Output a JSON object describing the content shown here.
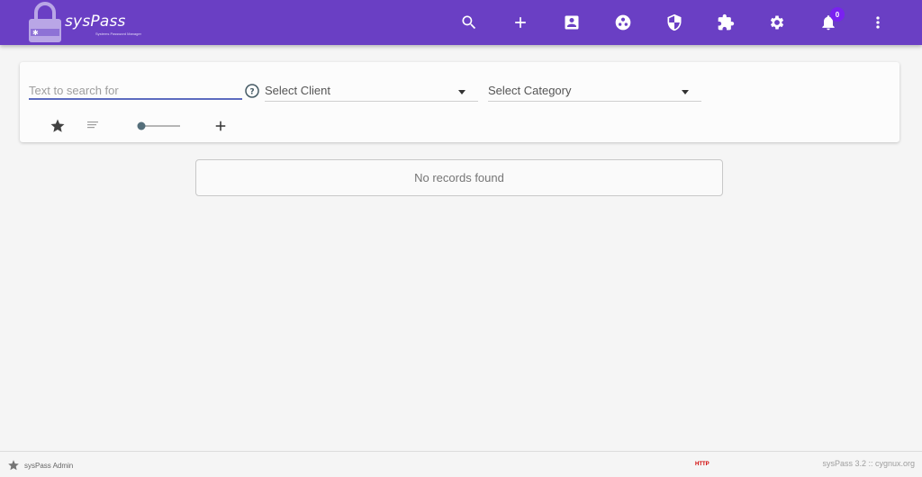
{
  "header": {
    "brand": "sysPass",
    "tagline": "Systems Password Manager",
    "notification_count": "0",
    "icons": [
      "search-icon",
      "add-icon",
      "account-box-icon",
      "group-icon",
      "security-shield-icon",
      "extension-icon",
      "settings-icon",
      "notifications-icon",
      "more-vert-icon"
    ]
  },
  "search": {
    "placeholder": "Text to search for",
    "client_label": "Select Client",
    "category_label": "Select Category"
  },
  "results": {
    "empty_message": "No records found"
  },
  "footer": {
    "user": "sysPass Admin",
    "protocol": "HTTP",
    "version": "sysPass 3.2  ::  cygnux.org"
  },
  "colors": {
    "header_bg": "#6a3fc4",
    "badge_bg": "#7a21f0",
    "input_underline": "#5c6bc0",
    "protocol_warning": "#d00000"
  }
}
